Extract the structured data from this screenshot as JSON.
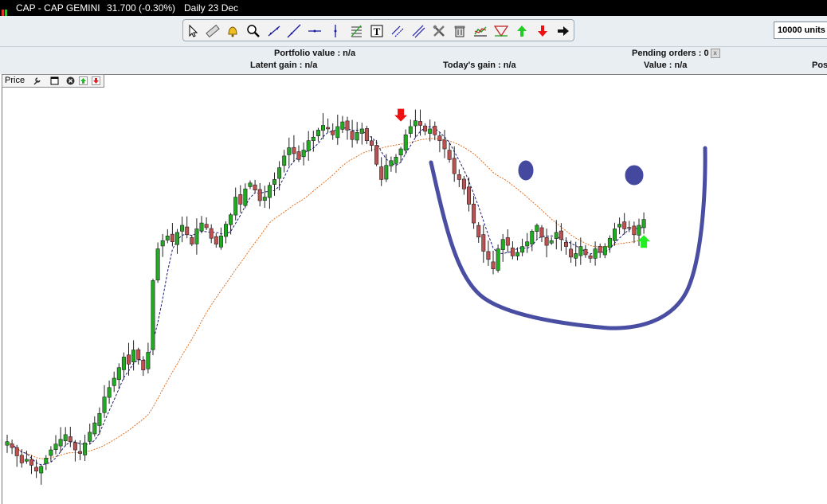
{
  "titlebar": {
    "symbol": "CAP - CAP GEMINI",
    "quote": "31.700 (-0.30%)",
    "period": "Daily  23 Dec"
  },
  "toolbar": {
    "tools": [
      "select-tool",
      "ruler-tool",
      "alert-tool",
      "zoom-tool",
      "trendline-tool",
      "line-tool",
      "horizontal-line-tool",
      "vertical-line-tool",
      "fibonacci-tool",
      "text-tool",
      "channel-tool",
      "parallel-tool",
      "tools-settings",
      "delete-tool",
      "indicator-tool",
      "pattern-tool",
      "buy-arrow-tool",
      "sell-arrow-tool",
      "next-tool"
    ]
  },
  "order_quantity": "10000 units",
  "info": {
    "portfolio_value": "Portfolio value : n/a",
    "latent_gain": "Latent gain : n/a",
    "todays_gain": "Today's gain : n/a",
    "pending_orders": "Pending orders : 0",
    "value": "Value : n/a",
    "position": "Pos"
  },
  "panel": {
    "label": "Price"
  },
  "colors": {
    "up_candle": "#22aa22",
    "down_candle": "#c05050",
    "ma_short": "#1a1a7a",
    "ma_long": "#e07020",
    "annotation": "#3a3f9a",
    "sell_arrow": "#ee1111",
    "buy_arrow": "#22ee22"
  },
  "chart_data": {
    "type": "candlestick",
    "closes": [
      7.8,
      7.3,
      6.6,
      6.0,
      6.3,
      5.8,
      5.3,
      5.7,
      6.4,
      7.1,
      7.6,
      8.0,
      8.4,
      7.8,
      7.1,
      6.8,
      7.7,
      8.6,
      9.4,
      10.2,
      11.6,
      12.4,
      13.2,
      14.1,
      15.0,
      14.4,
      15.6,
      14.8,
      13.9,
      15.4,
      21.5,
      24.2,
      24.9,
      25.3,
      24.8,
      25.6,
      26.2,
      25.4,
      24.6,
      25.9,
      26.4,
      26.0,
      25.1,
      24.6,
      25.3,
      26.3,
      27.1,
      28.6,
      28.0,
      29.3,
      29.8,
      29.2,
      28.3,
      28.6,
      29.6,
      30.1,
      31.1,
      32.1,
      32.8,
      32.3,
      31.8,
      32.6,
      33.4,
      33.7,
      34.3,
      34.7,
      34.4,
      33.9,
      34.6,
      35.0,
      34.3,
      33.5,
      34.1,
      34.4,
      33.4,
      33.0,
      31.4,
      30.1,
      31.3,
      31.7,
      32.0,
      32.7,
      33.9,
      34.6,
      35.1,
      34.7,
      34.2,
      34.4,
      33.9,
      33.4,
      32.7,
      31.8,
      30.6,
      30.1,
      29.3,
      28.0,
      26.4,
      25.2,
      24.0,
      23.3,
      22.5,
      24.2,
      25.0,
      24.5,
      23.6,
      23.9,
      24.4,
      24.8,
      25.7,
      26.2,
      25.2,
      24.5,
      24.9,
      25.6,
      25.0,
      24.4,
      23.5,
      23.8,
      24.4,
      23.7,
      23.4,
      24.2,
      23.9,
      24.4,
      25.1,
      25.9,
      26.3,
      25.9,
      26.0,
      25.4,
      26.2,
      26.7
    ],
    "moving_averages": [
      {
        "style": "dashed",
        "color": "ma_short",
        "period": 5
      },
      {
        "style": "dotted",
        "color": "ma_long",
        "period": 25
      }
    ],
    "signals": [
      {
        "type": "sell",
        "index": 81
      },
      {
        "type": "buy",
        "index": 131
      }
    ],
    "annotations": [
      "left-eye",
      "right-eye",
      "smile-curve"
    ],
    "ylim": [
      2.5,
      39.0
    ]
  }
}
